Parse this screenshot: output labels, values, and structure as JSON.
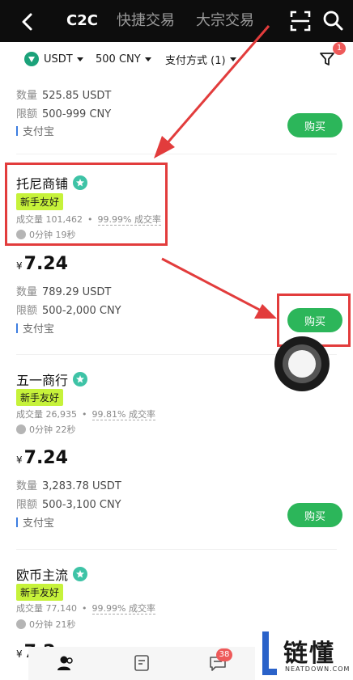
{
  "header": {
    "tabs": [
      {
        "label": "C2C",
        "active": true
      },
      {
        "label": "快捷交易",
        "active": false
      },
      {
        "label": "大宗交易",
        "active": false
      }
    ]
  },
  "filter": {
    "coin": "USDT",
    "amount": "500 CNY",
    "payment": "支付方式 (1)",
    "filter_badge": "1"
  },
  "labels": {
    "quantity": "数量",
    "limit": "限额",
    "new_user_tag": "新手友好",
    "volume": "成交量",
    "completion": "成交率",
    "buy": "购买",
    "currency_symbol": "¥"
  },
  "ads": [
    {
      "quantity": "525.85 USDT",
      "limit": "500-999 CNY",
      "payment": "支付宝"
    },
    {
      "merchant": "托尼商铺",
      "volume": "101,462",
      "completion_rate": "99.99%",
      "time": "0分钟 19秒",
      "price": "7.24",
      "quantity": "789.29 USDT",
      "limit": "500-2,000 CNY",
      "payment": "支付宝"
    },
    {
      "merchant": "五一商行",
      "volume": "26,935",
      "completion_rate": "99.81%",
      "time": "0分钟 22秒",
      "price": "7.24",
      "quantity": "3,283.78 USDT",
      "limit": "500-3,100 CNY",
      "payment": "支付宝"
    },
    {
      "merchant": "欧币主流",
      "volume": "77,140",
      "completion_rate": "99.99%",
      "time": "0分钟 21秒",
      "price": "7.2"
    }
  ],
  "bottom_nav": {
    "messages_badge": "38"
  },
  "watermark": {
    "text": "链懂",
    "sub": "NEATDOWN.COM"
  },
  "colors": {
    "buy_button": "#2cb65a",
    "new_user_tag": "#c6f23a",
    "highlight": "#e23c3c",
    "payment_bar": "#3d7de0"
  }
}
